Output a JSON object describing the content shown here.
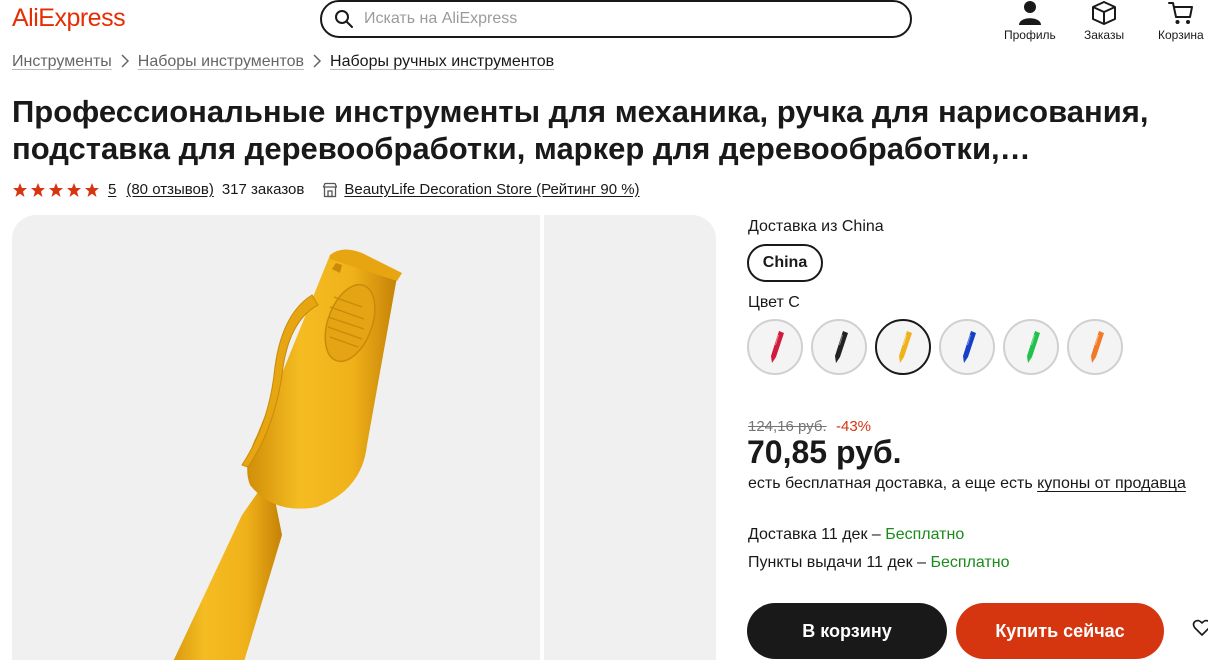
{
  "header": {
    "logo": "AliExpress",
    "search_placeholder": "Искать на AliExpress",
    "profile_label": "Профиль",
    "orders_label": "Заказы",
    "cart_label": "Корзина"
  },
  "breadcrumb": [
    "Инструменты",
    "Наборы инструментов",
    "Наборы ручных инструментов"
  ],
  "product": {
    "title": "Профессиональные инструменты для механика, ручка для нарисования, подставка для деревообработки, маркер для деревообработки,…",
    "rating": "5",
    "reviews": "(80 отзывов)",
    "orders": "317 заказов",
    "store": "BeautyLife Decoration Store (Рейтинг 90 %)"
  },
  "shipping": {
    "from_label": "Доставка из China",
    "origin_option": "China"
  },
  "color": {
    "label": "Цвет С",
    "swatches": [
      {
        "name": "red",
        "color": "#d11a3c"
      },
      {
        "name": "black",
        "color": "#222222"
      },
      {
        "name": "yellow",
        "color": "#f0b21a"
      },
      {
        "name": "blue",
        "color": "#1540c8"
      },
      {
        "name": "green",
        "color": "#22c24a"
      },
      {
        "name": "orange",
        "color": "#f07a28"
      }
    ],
    "selected_index": 2
  },
  "price": {
    "old": "124,16 руб.",
    "discount": "-43%",
    "current": "70,85 руб.",
    "note_prefix": "есть бесплатная доставка, а еще есть ",
    "note_link": "купоны от продавца"
  },
  "delivery": {
    "home_prefix": "Доставка 11 дек – ",
    "home_free": "Бесплатно",
    "pickup_prefix": "Пункты выдачи 11 дек – ",
    "pickup_free": "Бесплатно"
  },
  "actions": {
    "cart": "В корзину",
    "buy": "Купить сейчас"
  },
  "colors": {
    "accent": "#d6360f",
    "logo": "#e62e04",
    "pen": "#f0b21a",
    "free": "#1a8a1a"
  }
}
